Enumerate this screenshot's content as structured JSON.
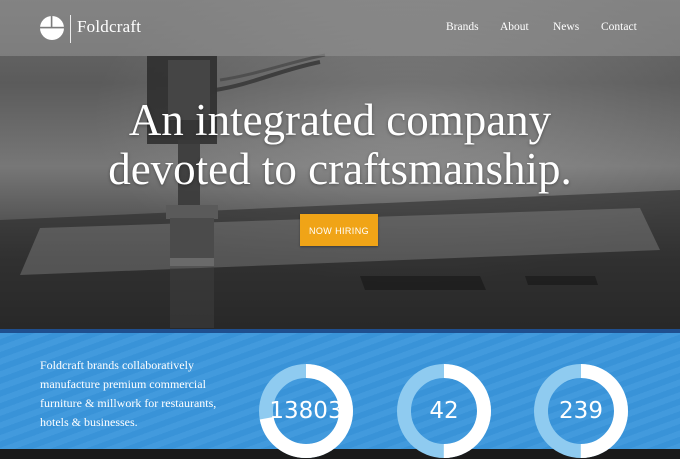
{
  "brand": {
    "name": "Foldcraft"
  },
  "nav": {
    "items": [
      "Brands",
      "About",
      "News",
      "Contact"
    ]
  },
  "hero": {
    "headline_line1": "An integrated company",
    "headline_line2": "devoted to craftsmanship.",
    "cta_label": "NOW HIRING"
  },
  "about": {
    "text": "Foldcraft brands collaboratively manufacture premium commercial furniture & millwork for restaurants, hotels & businesses."
  },
  "stats": [
    {
      "value": "13803",
      "fill_fraction": 0.72
    },
    {
      "value": "42",
      "fill_fraction": 0.5
    },
    {
      "value": "239",
      "fill_fraction": 0.5
    }
  ],
  "colors": {
    "accent": "#f0a417",
    "section_blue": "#3a96dc",
    "ring_track": "#8fcbf0",
    "ring_fill": "#ffffff"
  },
  "icons": {
    "logo": "circle-quadrant-logo-icon"
  }
}
